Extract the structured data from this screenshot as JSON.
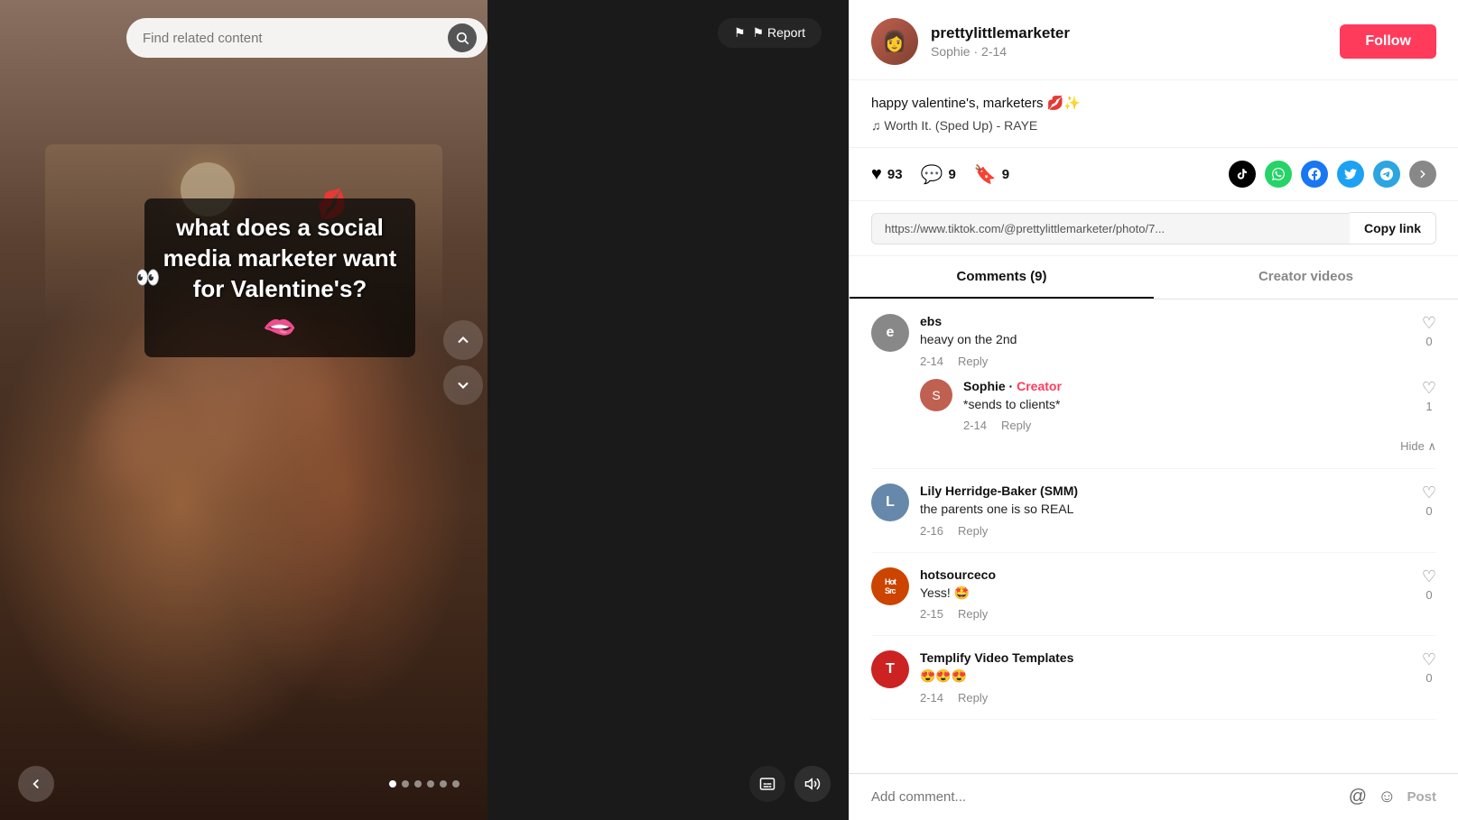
{
  "search": {
    "placeholder": "Find related content"
  },
  "report_button": "⚑ Report",
  "media": {
    "text_overlay": "what does a social media marketer want for Valentine's?",
    "emoji_face": "🫦",
    "emoji_eyes": "👀",
    "red_accent": "💋"
  },
  "navigation": {
    "prev_arrow": "‹",
    "next_arrow": "›",
    "up_arrow": "∧",
    "down_arrow": "∨",
    "dots": [
      1,
      2,
      3,
      4,
      5,
      6
    ],
    "active_dot": 0
  },
  "creator": {
    "username": "prettylittlemarketer",
    "display_name": "Sophie",
    "post_date": "2-14",
    "follow_label": "Follow",
    "caption": "happy valentine's, marketers 💋✨",
    "music": "♫  Worth It. (Sped Up) - RAYE",
    "avatar_emoji": "👩"
  },
  "interactions": {
    "likes": 93,
    "comments": 9,
    "bookmarks": 9,
    "like_icon": "♥",
    "comment_icon": "💬",
    "bookmark_icon": "🔖"
  },
  "share_icons": {
    "tiktok": "T",
    "whatsapp": "W",
    "facebook": "f",
    "twitter": "t",
    "telegram": "✈",
    "more": "→"
  },
  "link": {
    "url": "https://www.tiktok.com/@prettylittlemarketer/photo/7...",
    "copy_label": "Copy link"
  },
  "tabs": [
    {
      "label": "Comments (9)",
      "active": true
    },
    {
      "label": "Creator videos",
      "active": false
    }
  ],
  "comments": [
    {
      "id": "ebs",
      "username": "ebs",
      "text": "heavy on the 2nd",
      "date": "2-14",
      "likes": 0,
      "avatar_color": "#888888",
      "avatar_text": "e",
      "replies": [
        {
          "username": "Sophie",
          "badge": "Creator",
          "text": "*sends to clients*",
          "date": "2-14",
          "likes": 1,
          "avatar_color": "#c06050",
          "avatar_text": "S"
        }
      ],
      "show_hide": true
    },
    {
      "id": "lily",
      "username": "Lily Herridge-Baker (SMM)",
      "text": "the parents one is so REAL",
      "date": "2-16",
      "likes": 0,
      "avatar_color": "#6688aa",
      "avatar_text": "L",
      "replies": []
    },
    {
      "id": "hotsource",
      "username": "hotsourceco",
      "text": "Yess! 🤩",
      "date": "2-15",
      "likes": 0,
      "avatar_color": "#cc4400",
      "avatar_text": "H",
      "replies": []
    },
    {
      "id": "templify",
      "username": "Templify Video Templates",
      "text": "😍😍😍",
      "date": "2-14",
      "likes": 0,
      "avatar_color": "#cc2222",
      "avatar_text": "T",
      "replies": []
    }
  ],
  "comment_input": {
    "placeholder": "Add comment...",
    "post_label": "Post",
    "mention_icon": "@",
    "emoji_icon": "☺"
  }
}
